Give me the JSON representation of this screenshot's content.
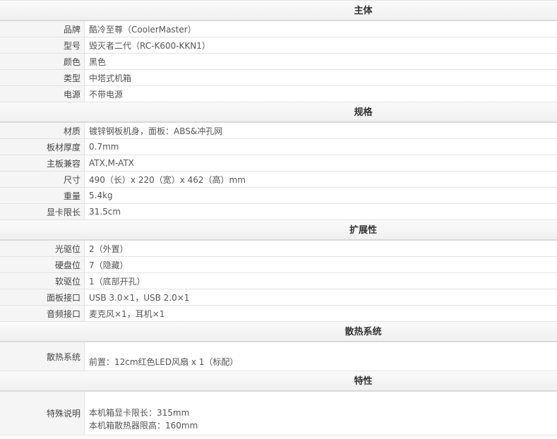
{
  "sections": [
    {
      "title": "主体",
      "rows": [
        {
          "k": "品牌",
          "v": "酷冷至尊（CoolerMaster）"
        },
        {
          "k": "型号",
          "v": "毁灭者二代（RC-K600-KKN1）"
        },
        {
          "k": "颜色",
          "v": "黑色"
        },
        {
          "k": "类型",
          "v": "中塔式机箱"
        },
        {
          "k": "电源",
          "v": "不带电源"
        }
      ]
    },
    {
      "title": "规格",
      "rows": [
        {
          "k": "材质",
          "v": "镀锌钢板机身，面板：ABS&冲孔网"
        },
        {
          "k": "板材厚度",
          "v": "0.7mm"
        },
        {
          "k": "主板兼容",
          "v": "ATX,M-ATX"
        },
        {
          "k": "尺寸",
          "v": "490（长）x 220（宽）x 462（高）mm"
        },
        {
          "k": "重量",
          "v": "5.4kg"
        },
        {
          "k": "显卡限长",
          "v": "31.5cm"
        }
      ]
    },
    {
      "title": "扩展性",
      "rows": [
        {
          "k": "光驱位",
          "v": "2（外置）"
        },
        {
          "k": "硬盘位",
          "v": "7（隐藏）"
        },
        {
          "k": "软驱位",
          "v": "1（底部开孔）"
        },
        {
          "k": "面板接口",
          "v": "USB 3.0×1，USB 2.0×1"
        },
        {
          "k": "音频接口",
          "v": "麦克风×1，耳机×1"
        }
      ]
    },
    {
      "title": "散热系统",
      "rows": [
        {
          "k": "散热系统",
          "v": "前置：12cm红色LED风扇 x 1（标配）"
        }
      ]
    },
    {
      "title": "特性",
      "rows": [
        {
          "k": "特殊说明",
          "v1": "本机箱显卡限长：315mm",
          "v2": "本机箱散热器限高：160mm"
        }
      ]
    }
  ]
}
